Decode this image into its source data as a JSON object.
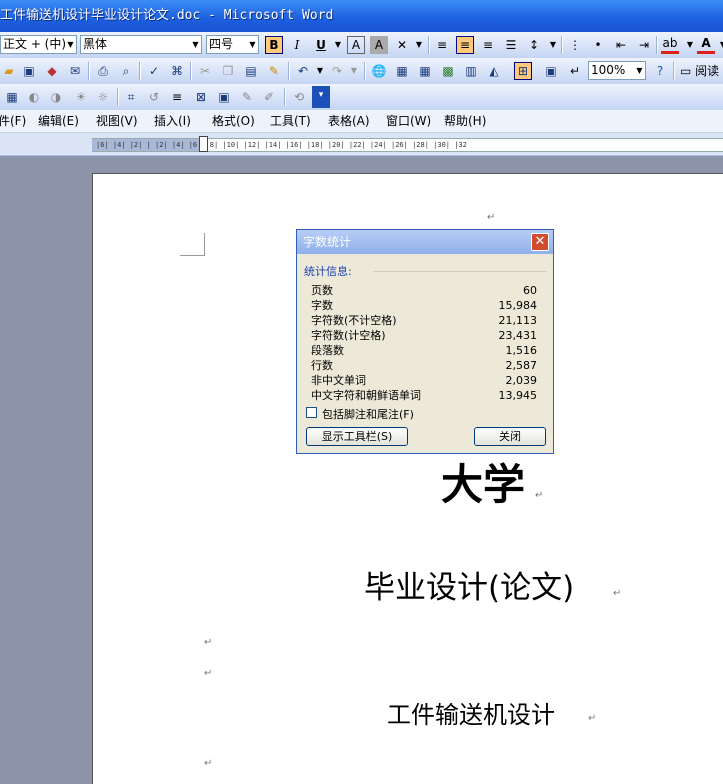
{
  "window": {
    "title": "工件输送机设计毕业设计论文.doc - Microsoft Word"
  },
  "formatting_toolbar": {
    "style_value": "正文 + (中)",
    "font_value": "黑体",
    "size_value": "四号",
    "bold": "B",
    "italic": "I",
    "underline": "U"
  },
  "standard_toolbar": {
    "zoom_value": "100%",
    "read_label": "阅读"
  },
  "menu": [
    {
      "label": "文件(F)"
    },
    {
      "label": "编辑(E)"
    },
    {
      "label": "视图(V)"
    },
    {
      "label": "插入(I)"
    },
    {
      "label": "格式(O)"
    },
    {
      "label": "工具(T)"
    },
    {
      "label": "表格(A)"
    },
    {
      "label": "窗口(W)"
    },
    {
      "label": "帮助(H)"
    }
  ],
  "ruler": {
    "ticks": "|6| |4| |2| |  |2| |4| |6| |8| |10| |12| |14| |16| |18| |20| |22| |24| |26| |28| |30| |32"
  },
  "document": {
    "line1": "大学",
    "line2": "毕业设计(论文)",
    "line3": "工件输送机设计",
    "para_mark": "↵"
  },
  "dialog": {
    "title": "字数统计",
    "group_label": "统计信息:",
    "stats": [
      {
        "label": "页数",
        "value": "60"
      },
      {
        "label": "字数",
        "value": "15,984"
      },
      {
        "label": "字符数(不计空格)",
        "value": "21,113"
      },
      {
        "label": "字符数(计空格)",
        "value": "23,431"
      },
      {
        "label": "段落数",
        "value": "1,516"
      },
      {
        "label": "行数",
        "value": "2,587"
      },
      {
        "label": "非中文单词",
        "value": "2,039"
      },
      {
        "label": "中文字符和朝鲜语单词",
        "value": "13,945"
      }
    ],
    "checkbox_label": "包括脚注和尾注(F)",
    "toolbar_button": "显示工具栏(S)",
    "close_button": "关闭"
  }
}
